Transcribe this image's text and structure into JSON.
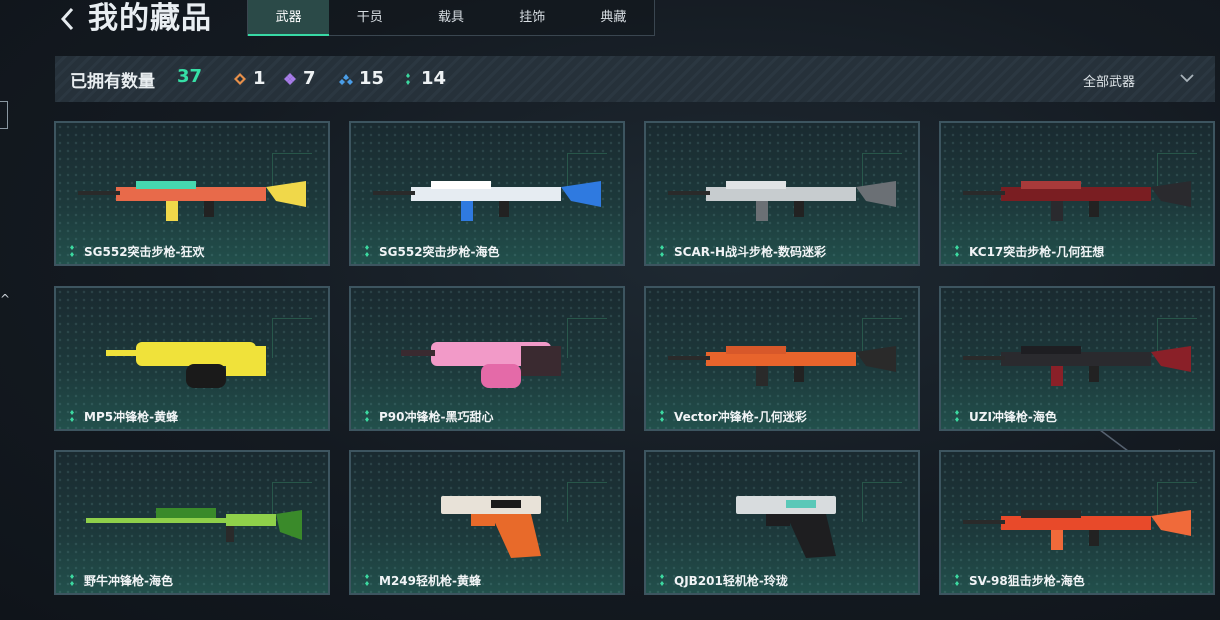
{
  "header": {
    "title": "我的藏品",
    "back_icon": "chevron-left-icon"
  },
  "tabs": [
    {
      "label": "武器",
      "active": true
    },
    {
      "label": "干员",
      "active": false
    },
    {
      "label": "载具",
      "active": false
    },
    {
      "label": "挂饰",
      "active": false
    },
    {
      "label": "典藏",
      "active": false
    }
  ],
  "summary": {
    "owned_label": "已拥有数量",
    "owned_count": "37",
    "rarities": [
      {
        "icon": "orange-diamond-icon",
        "count": "1",
        "color": "#e8904a"
      },
      {
        "icon": "purple-diamond-icon",
        "count": "7",
        "color": "#a77ce8"
      },
      {
        "icon": "blue-diamond-icon",
        "count": "15",
        "color": "#4a9ee8"
      },
      {
        "icon": "green-diamond-icon",
        "count": "14",
        "color": "#3cd9a0"
      }
    ],
    "filter_label": "全部武器"
  },
  "cards": [
    {
      "name": "SG552突击步枪-狂欢",
      "weapon": "rifle-icon",
      "colors": [
        "#e86a4a",
        "#f0d84a",
        "#46d8b0"
      ]
    },
    {
      "name": "SG552突击步枪-海色",
      "weapon": "rifle-icon",
      "colors": [
        "#e6ecf2",
        "#2f7ae0",
        "#ffffff"
      ]
    },
    {
      "name": "SCAR-H战斗步枪-数码迷彩",
      "weapon": "rifle-icon",
      "colors": [
        "#c7cccf",
        "#6b7075",
        "#e0e3e5"
      ]
    },
    {
      "name": "KC17突击步枪-几何狂想",
      "weapon": "rifle-icon",
      "colors": [
        "#7a1e22",
        "#2a2a2e",
        "#a83a3a"
      ]
    },
    {
      "name": "MP5冲锋枪-黄蜂",
      "weapon": "smg-icon",
      "colors": [
        "#f0e23a",
        "#1a1a1a",
        "#f0e23a"
      ]
    },
    {
      "name": "P90冲锋枪-黑巧甜心",
      "weapon": "smg-icon",
      "colors": [
        "#f29ac8",
        "#e46aa8",
        "#3a2a30"
      ]
    },
    {
      "name": "Vector冲锋枪-几何迷彩",
      "weapon": "rifle-icon",
      "colors": [
        "#e8642c",
        "#2a2a2a",
        "#d8582a"
      ]
    },
    {
      "name": "UZI冲锋枪-海色",
      "weapon": "rifle-icon",
      "colors": [
        "#2a2a2e",
        "#8a2028",
        "#1e1e22"
      ]
    },
    {
      "name": "野牛冲锋枪-海色",
      "weapon": "sniper-icon",
      "colors": [
        "#8fd04a",
        "#3a8a2a",
        "#2a2a2a"
      ]
    },
    {
      "name": "M249轻机枪-黄蜂",
      "weapon": "pistol-icon",
      "colors": [
        "#e8e2d8",
        "#e86a2a",
        "#1a1a1a"
      ]
    },
    {
      "name": "QJB201轻机枪-玲珑",
      "weapon": "pistol-icon",
      "colors": [
        "#d8dcde",
        "#1e1e20",
        "#5ac8b8"
      ]
    },
    {
      "name": "SV-98狙击步枪-海色",
      "weapon": "rifle-icon",
      "colors": [
        "#e84a2a",
        "#f06a3a",
        "#2a2a2a"
      ]
    }
  ]
}
